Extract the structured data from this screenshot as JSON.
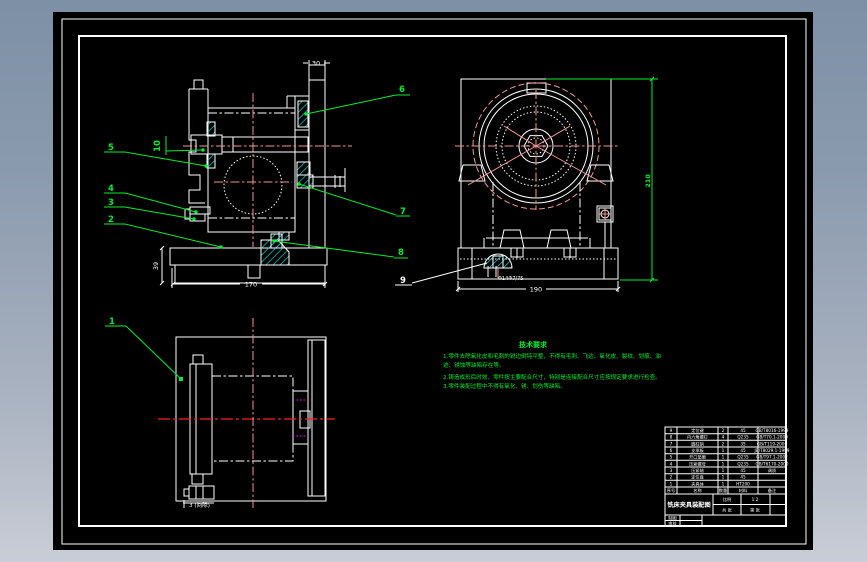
{
  "app": {
    "background_top": "#7e90a6",
    "background_bottom": "#c9cdd6",
    "canvas_color": "#000000",
    "line_color": "#ffffff",
    "annotation_color": "#00ef2d",
    "hatch_color": "#00e5e5",
    "centerline_color": "#f49595",
    "highlight_centerline_color": "#ff1f1f",
    "hidden_line_color": "#ff00ff"
  },
  "drawing": {
    "balloons": {
      "b1": "1",
      "b2": "2",
      "b3": "3",
      "b4": "4",
      "b5": "5",
      "b6": "6",
      "b7": "7",
      "b8": "8",
      "b9": "9",
      "b10": "10"
    },
    "dimensions": {
      "plate_width": "30",
      "base_width": "170",
      "base_height": "39",
      "overall_height": "210",
      "base_width_right": "190",
      "slot_callout": "Φ14Φ7/75",
      "detail_note": "3 (间隙)"
    },
    "notes": {
      "title": "技术要求",
      "line1": "1.零件去除氧化皮和毛刺的锐边倒钝平整，不得有毛刺、飞边、氧化皮、裂纹、划痕、油",
      "line2": "迹、锈蚀等缺陷存在等。",
      "line3": "2.铸造成形后时效，零件按主要配合尺寸，特别是连接配合尺寸应按规定要求进行检查。",
      "line4": "3.零件装配过程中不得有氧化、锈、划伤等缺陷。"
    },
    "title_block": {
      "header": {
        "no": "序号",
        "name": "名称",
        "qty": "数量",
        "mat": "材料",
        "note": "备注"
      },
      "rows": [
        {
          "no": "9",
          "name": "定位键",
          "qty": "2",
          "mat": "45",
          "note": "GB/T8016-1999"
        },
        {
          "no": "8",
          "name": "内六角螺钉",
          "qty": "4",
          "mat": "Q235",
          "note": "GB/T70.1-2000"
        },
        {
          "no": "7",
          "name": "圆柱销",
          "qty": "2",
          "mat": "35",
          "note": "GB/T119-2000"
        },
        {
          "no": "6",
          "name": "支承板",
          "qty": "1",
          "mat": "45",
          "note": "JB/T8029.1-1999"
        },
        {
          "no": "5",
          "name": "开口垫圈",
          "qty": "1",
          "mat": "Q235",
          "note": "GB/T97.1-2002"
        },
        {
          "no": "4",
          "name": "压紧螺母",
          "qty": "1",
          "mat": "Q235",
          "note": "GB/T6170-2000"
        },
        {
          "no": "3",
          "name": "压紧轴",
          "qty": "1",
          "mat": "45",
          "note": "调质"
        },
        {
          "no": "2",
          "name": "定位盘",
          "qty": "1",
          "mat": "45",
          "note": ""
        },
        {
          "no": "1",
          "name": "夹具体",
          "qty": "1",
          "mat": "HT200",
          "note": ""
        }
      ],
      "title": "铣床夹具装配图",
      "scale_label": "比例",
      "scale_value": "1:2",
      "sheet_label": "共 张",
      "page_label": "第 张",
      "drafter_label": "制图",
      "checker_label": "审核"
    }
  }
}
